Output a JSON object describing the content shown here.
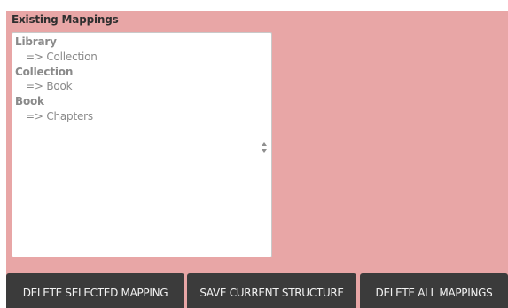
{
  "panel": {
    "title": "Existing Mappings"
  },
  "mappings": [
    {
      "group": "Library",
      "option": "=> Collection"
    },
    {
      "group": "Collection",
      "option": "=> Book"
    },
    {
      "group": "Book",
      "option": "=> Chapters"
    }
  ],
  "icons": {
    "listbox_stepper": "up-down-arrows-icon"
  },
  "buttons": {
    "delete_selected": "DELETE SELECTED MAPPING",
    "save_structure": "SAVE CURRENT STRUCTURE",
    "delete_all": "DELETE ALL MAPPINGS"
  },
  "colors": {
    "panel_background": "#e8a6a6",
    "button_background": "#3b3b3b",
    "list_text": "#8a8a8a"
  }
}
